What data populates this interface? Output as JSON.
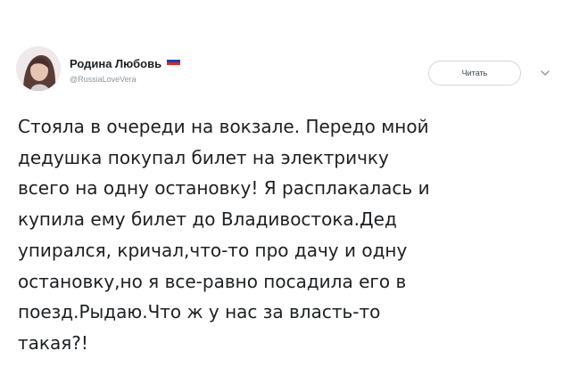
{
  "tweet": {
    "author": {
      "display_name": "Родина Любовь",
      "handle": "@RussiaLoveVera",
      "flag_colors": [
        "#ffffff",
        "#1f3fb0",
        "#d52b1e"
      ]
    },
    "follow_button_label": "Читать",
    "menu_icon": "chevron-down-icon",
    "text_lines": [
      "Стояла в очереди на вокзале. Передо мной",
      "дедушка покупал билет на электричку",
      "всего на одну остановку! Я расплакалась и",
      "купила ему билет до Владивостока.Дед",
      "упирался, кричал,что-то про дачу и одну",
      "остановку,но я все-равно посадила его в",
      "поезд.Рыдаю.Что ж у нас за власть-то",
      "такая?!"
    ]
  }
}
